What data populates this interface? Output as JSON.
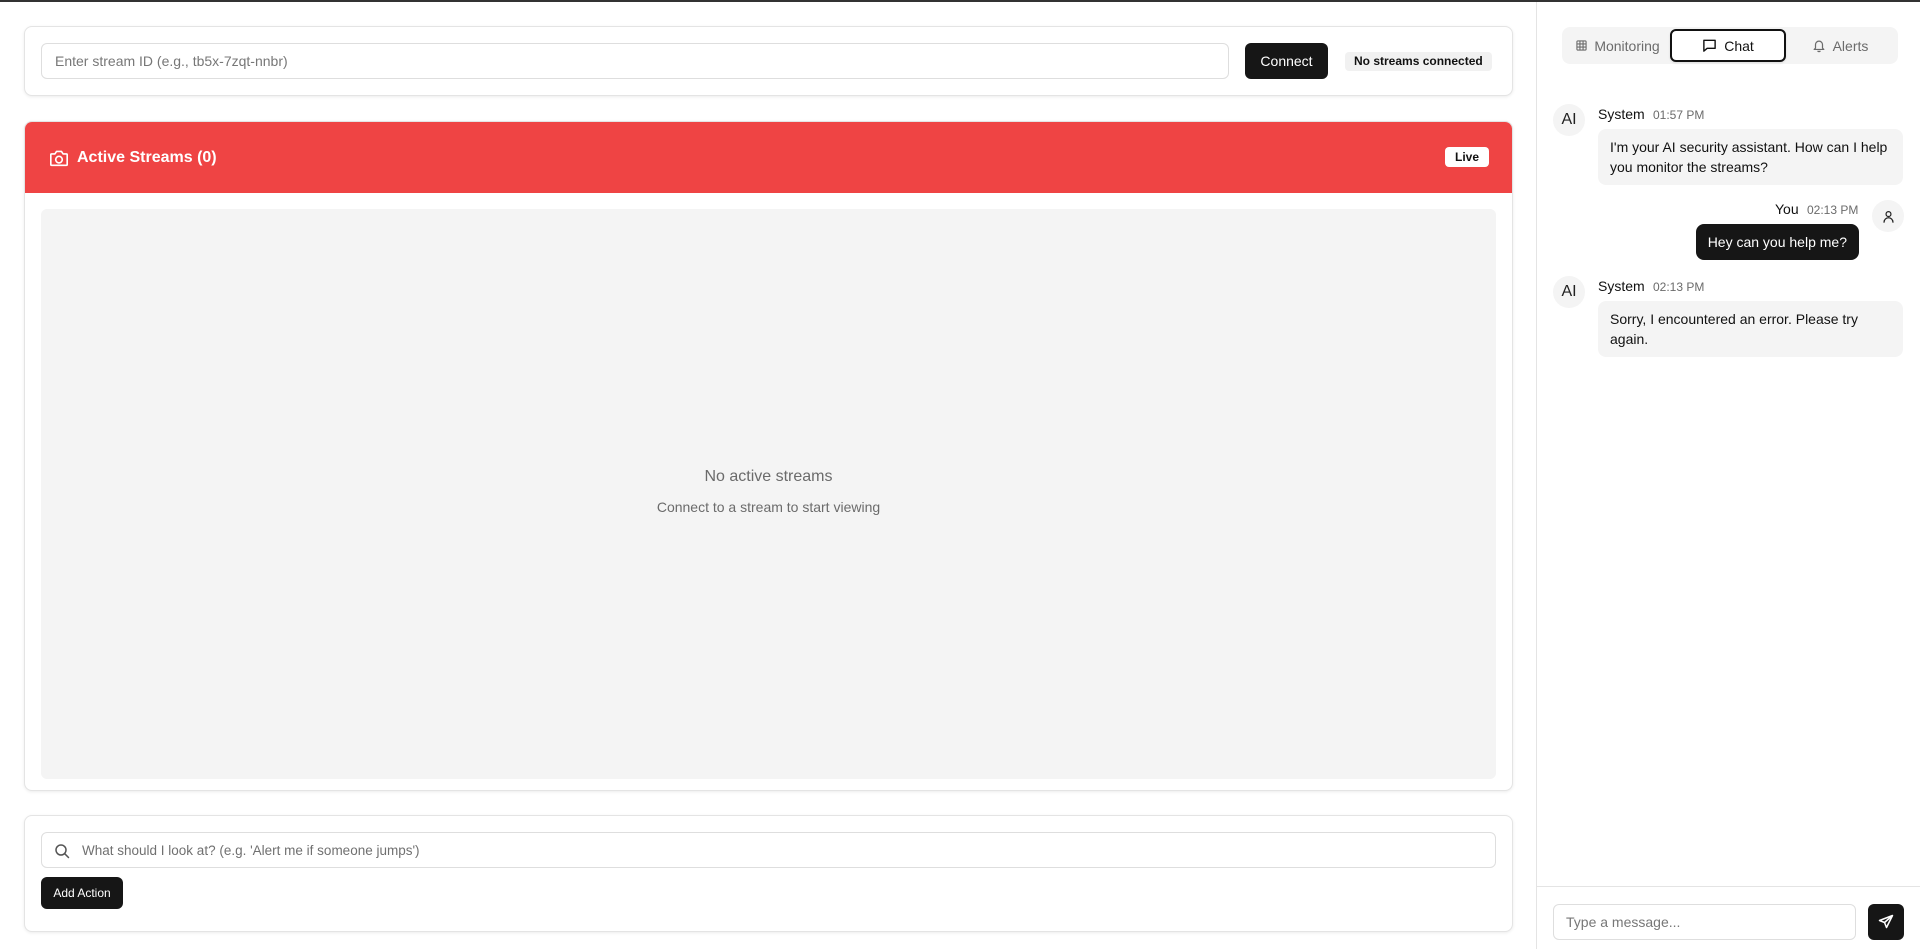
{
  "connect": {
    "stream_placeholder": "Enter stream ID (e.g., tb5x-7zqt-nnbr)",
    "stream_value": "",
    "connect_label": "Connect",
    "status": "No streams connected"
  },
  "streams": {
    "title": "Active Streams (0)",
    "live_label": "Live",
    "header_color": "#ef4444",
    "camera_icon": "camera-icon",
    "empty_title": "No active streams",
    "empty_subtitle": "Connect to a stream to start viewing"
  },
  "action": {
    "search_icon": "search-icon",
    "placeholder": "What should I look at? (e.g. 'Alert me if someone jumps')",
    "value": "",
    "add_label": "Add Action"
  },
  "sidebar": {
    "tabs": [
      {
        "label": "Monitoring",
        "icon": "grid-icon",
        "active": false
      },
      {
        "label": "Chat",
        "icon": "message-square-icon",
        "active": true
      },
      {
        "label": "Alerts",
        "icon": "bell-icon",
        "active": false
      }
    ],
    "messages": [
      {
        "sender": "System",
        "avatar": "AI",
        "time": "01:57 PM",
        "text": "I'm your AI security assistant. How can I help you monitor the streams?",
        "role": "ai"
      },
      {
        "sender": "You",
        "avatar": "user-icon",
        "time": "02:13 PM",
        "text": "Hey can you help me?",
        "role": "user"
      },
      {
        "sender": "System",
        "avatar": "AI",
        "time": "02:13 PM",
        "text": "Sorry, I encountered an error. Please try again.",
        "role": "ai"
      }
    ],
    "composer": {
      "placeholder": "Type a message...",
      "value": "",
      "send_icon": "send-icon"
    }
  }
}
